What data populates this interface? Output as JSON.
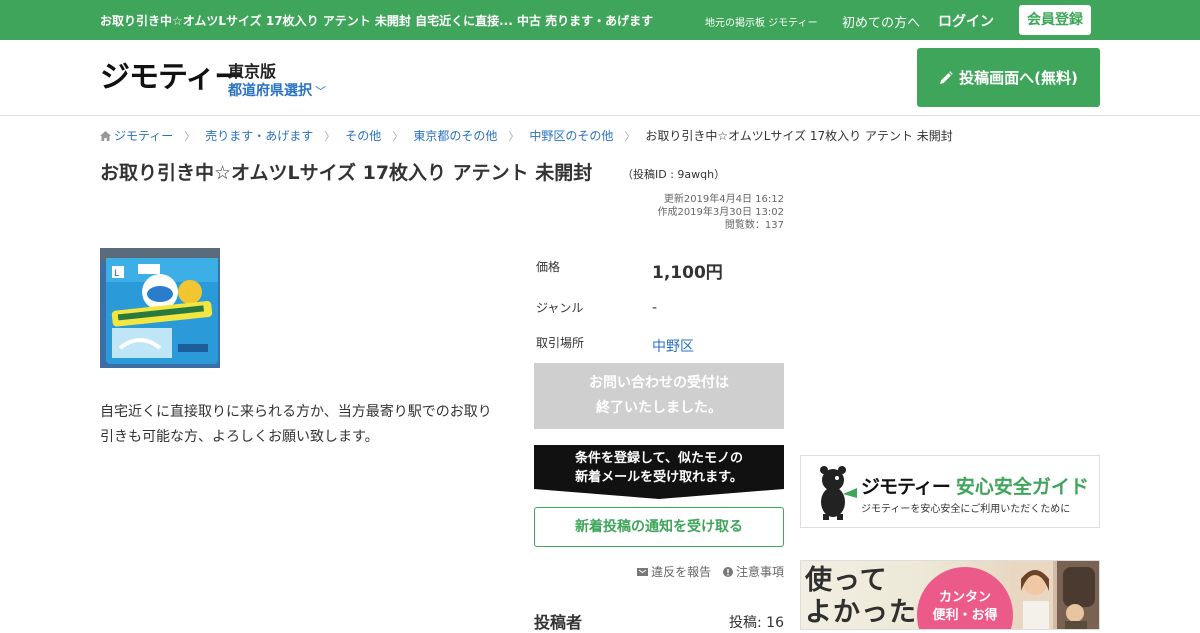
{
  "topbar": {
    "lead": "お取り引き中☆オムツLサイズ 17枚入り アテント 未開封 自宅近くに直接... 中古 売ります・あげます",
    "board": "地元の掲示板 ジモティー",
    "first_time": "初めての方へ",
    "login": "ログイン",
    "register": "会員登録",
    "accent": "#3ea55a"
  },
  "header": {
    "logo": "ジモティー",
    "edition": "東京版",
    "prefecture_select": "都道府県選択",
    "post_button": "投稿画面へ(無料)"
  },
  "breadcrumbs": [
    "ジモティー",
    "売ります・あげます",
    "その他",
    "東京都のその他",
    "中野区のその他",
    "お取り引き中☆オムツLサイズ 17枚入り アテント 未開封"
  ],
  "listing": {
    "title": "お取り引き中☆オムツLサイズ 17枚入り アテント 未開封",
    "post_id": "（投稿ID : 9awqh）",
    "updated": "更新2019年4月4日 16:12",
    "created": "作成2019年3月30日 13:02",
    "views": "閲覧数：137",
    "description": "自宅近くに直接取りに来られる方か、当方最寄り駅でのお取り引きも可能な方、よろしくお願い致します。",
    "details": {
      "price_label": "価格",
      "price": "1,100円",
      "genre_label": "ジャンル",
      "genre": "-",
      "place_label": "取引場所",
      "place": "中野区"
    },
    "closed_line1": "お問い合わせの受付は",
    "closed_line2": "終了いたしました。",
    "banner_line1": "条件を登録して、似たモノの",
    "banner_line2": "新着メールを受け取れます。",
    "notify_button": "新着投稿の通知を受け取る",
    "report": "違反を報告",
    "notes": "注意事項",
    "poster_label": "投稿者",
    "poster_count": "投稿: 16"
  },
  "ads": {
    "guide_brand": "ジモティー",
    "guide_title": "安心安全ガイド",
    "guide_sub": "ジモティーを安心安全にご利用いただくために",
    "ad2_big_line1": "使って",
    "ad2_big_line2": "よかった",
    "ad2_badge_line1": "カンタン",
    "ad2_badge_line2": "便利・お得"
  }
}
